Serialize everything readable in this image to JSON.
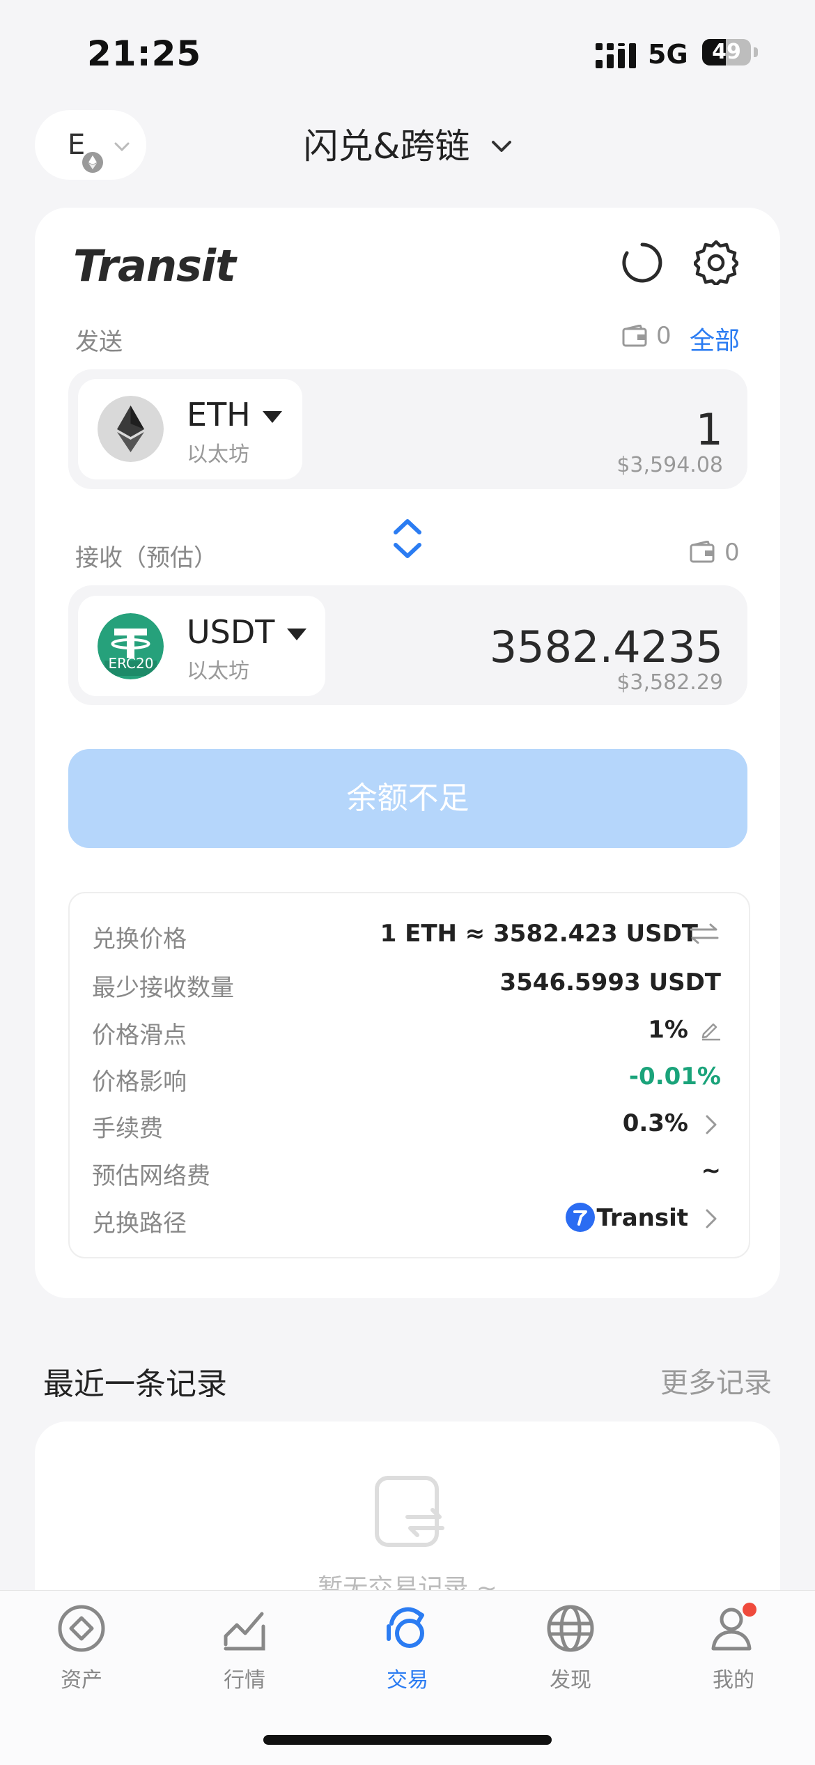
{
  "status_bar": {
    "time": "21:25",
    "network": "5G",
    "battery": "49"
  },
  "header": {
    "wallet_letter": "E",
    "title": "闪兑&跨链"
  },
  "brand": "Transit",
  "send": {
    "label": "发送",
    "balance": "0",
    "all_label": "全部",
    "token": {
      "symbol": "ETH",
      "network": "以太坊"
    },
    "amount": "1",
    "usd": "$3,594.08"
  },
  "receive": {
    "label": "接收（预估）",
    "balance": "0",
    "token": {
      "symbol": "USDT",
      "network": "以太坊",
      "badge": "ERC20"
    },
    "amount": "3582.4235",
    "usd": "$3,582.29"
  },
  "cta_label": "余额不足",
  "details": [
    {
      "label": "兑换价格",
      "value": "1 ETH ≈ 3582.423 USDT"
    },
    {
      "label": "最少接收数量",
      "value": "3546.5993 USDT"
    },
    {
      "label": "价格滑点",
      "value": "1%"
    },
    {
      "label": "价格影响",
      "value": "-0.01%"
    },
    {
      "label": "手续费",
      "value": "0.3%"
    },
    {
      "label": "预估网络费",
      "value": "~"
    },
    {
      "label": "兑换路径",
      "value": "Transit"
    }
  ],
  "recent": {
    "title": "最近一条记录",
    "more_label": "更多记录",
    "empty_text": "暂无交易记录 ~"
  },
  "tabs": [
    {
      "label": "资产",
      "icon": "assets-icon"
    },
    {
      "label": "行情",
      "icon": "market-icon"
    },
    {
      "label": "交易",
      "icon": "trade-icon",
      "active": true
    },
    {
      "label": "发现",
      "icon": "discover-icon"
    },
    {
      "label": "我的",
      "icon": "profile-icon"
    }
  ],
  "colors": {
    "accent": "#2b7cf2",
    "cta_disabled": "#b5d6fb",
    "impact_green": "#1aa37a",
    "usdt_green": "#26a17b"
  }
}
